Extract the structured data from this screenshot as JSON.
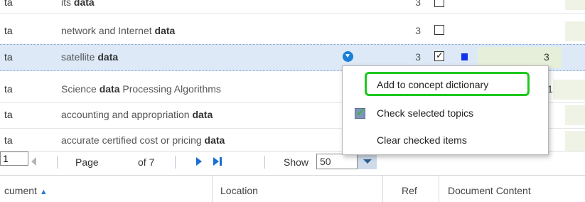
{
  "rows": [
    {
      "col1": "ta",
      "term_pre": "network and Internet ",
      "term_bold": "data",
      "term_post": "",
      "ref": "3"
    },
    {
      "col1": "ta",
      "term_pre": "satellite ",
      "term_bold": "data",
      "term_post": "",
      "ref": "3",
      "bar_value": "3"
    },
    {
      "col1": "ta",
      "term_pre": "Science ",
      "term_bold": "data",
      "term_post": " Processing Algorithms",
      "ref": "1"
    },
    {
      "col1": "ta",
      "term_pre": "accounting and appropriation ",
      "term_bold": "data",
      "term_post": ""
    },
    {
      "col1": "ta",
      "term_pre": "accurate certified cost or pricing ",
      "term_bold": "data",
      "term_post": ""
    }
  ],
  "top_partial": {
    "term_pre": "its ",
    "term_bold": "data",
    "ref": "3"
  },
  "pager": {
    "page_label": "Page",
    "page_value": "1",
    "of_label": "of 7",
    "show_label": "Show",
    "show_value": "50"
  },
  "columns": {
    "document": "cument",
    "location": "Location",
    "ref": "Ref",
    "content": "Document Content"
  },
  "context_menu": {
    "items": [
      "Add to concept dictionary",
      "Check selected topics",
      "Clear checked items"
    ]
  },
  "colors": {
    "highlight_border": "#1ec81e",
    "selected_row": "#dde9f7",
    "accent": "#1a7fd8"
  }
}
